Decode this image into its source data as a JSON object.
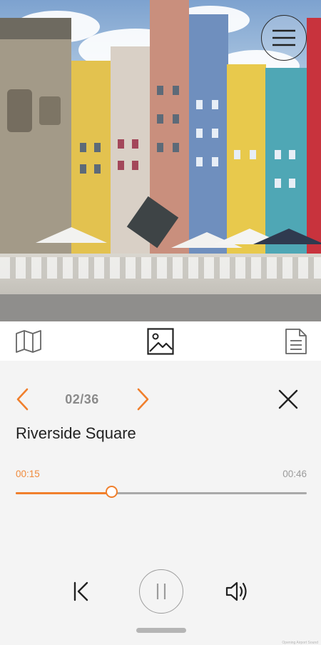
{
  "photo": {
    "alt": "Riverside Square photo"
  },
  "menu": {
    "icon": "hamburger-menu-icon"
  },
  "tabs": [
    {
      "icon": "map-icon",
      "active": false
    },
    {
      "icon": "image-icon",
      "active": true
    },
    {
      "icon": "document-icon",
      "active": false
    }
  ],
  "player": {
    "counter": "02/36",
    "title": "Riverside Square",
    "current_time": "00:15",
    "duration": "00:46",
    "progress": 0.33,
    "credit": "Opening Airport Sound"
  },
  "colors": {
    "accent": "#f07f2c",
    "muted": "#8a8a8a",
    "track": "#a9a9a9"
  }
}
